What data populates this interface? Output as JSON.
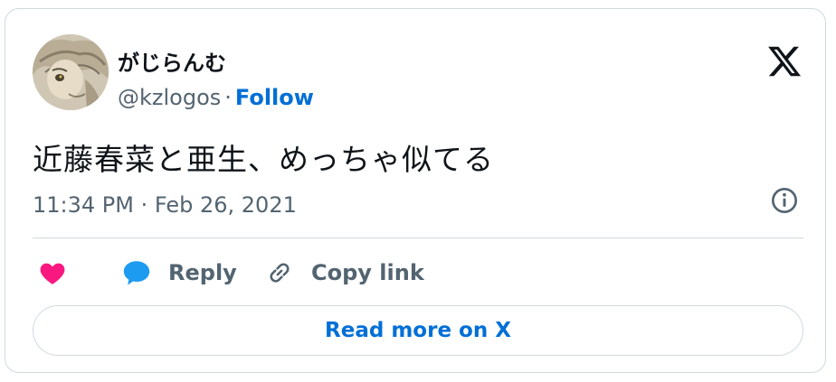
{
  "author": {
    "display_name": "がじらんむ",
    "handle": "@kzlogos",
    "separator": "·",
    "follow_label": "Follow",
    "avatar_icon": "anime-character-avatar"
  },
  "tweet": {
    "text": "近藤春菜と亜生、めっちゃ似てる",
    "timestamp": "11:34 PM · Feb 26, 2021"
  },
  "actions": {
    "like_icon": "heart-icon",
    "reply_label": "Reply",
    "copy_label": "Copy link"
  },
  "footer": {
    "read_more_label": "Read more on X"
  },
  "colors": {
    "link_blue": "#006fd6",
    "like_pink": "#f91880",
    "reply_blue": "#1d9bf0",
    "muted_text": "#536471",
    "border": "#cfd9de"
  }
}
